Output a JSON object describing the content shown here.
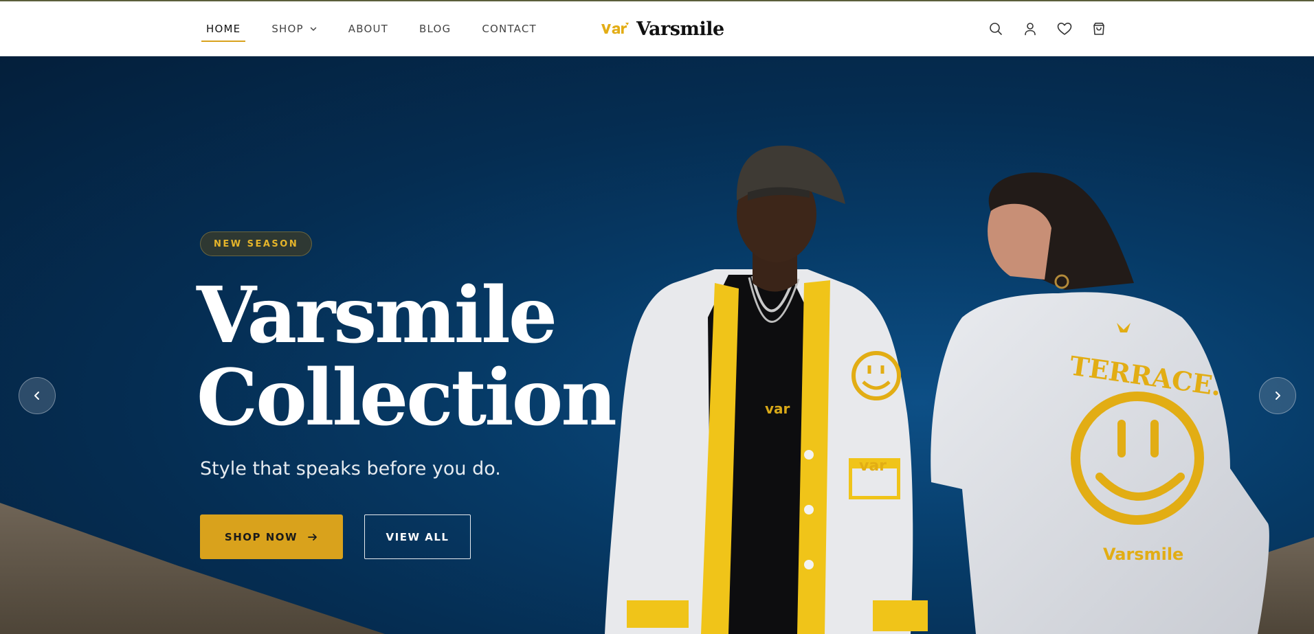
{
  "nav": {
    "items": [
      {
        "label": "HOME",
        "active": true
      },
      {
        "label": "SHOP",
        "has_dropdown": true
      },
      {
        "label": "ABOUT"
      },
      {
        "label": "BLOG"
      },
      {
        "label": "CONTACT"
      }
    ],
    "icons": [
      "search-icon",
      "user-icon",
      "heart-icon",
      "cart-icon"
    ]
  },
  "logo": {
    "mark_text": "var",
    "name": "Varsmile"
  },
  "hero": {
    "badge": "NEW SEASON",
    "title_line1": "Varsmile",
    "title_line2": "Collection",
    "subtitle": "Style that speaks before you do.",
    "primary_button": "SHOP NOW",
    "secondary_button": "VIEW ALL",
    "image_texts": {
      "cardigan_chest": "var",
      "cardigan_patch": "var",
      "shirt_top": "TERRACE.",
      "shirt_bottom": "Varsmile"
    }
  },
  "colors": {
    "accent": "#d9a21c",
    "hero_blue": "#063a66",
    "text_dark": "#111111"
  }
}
